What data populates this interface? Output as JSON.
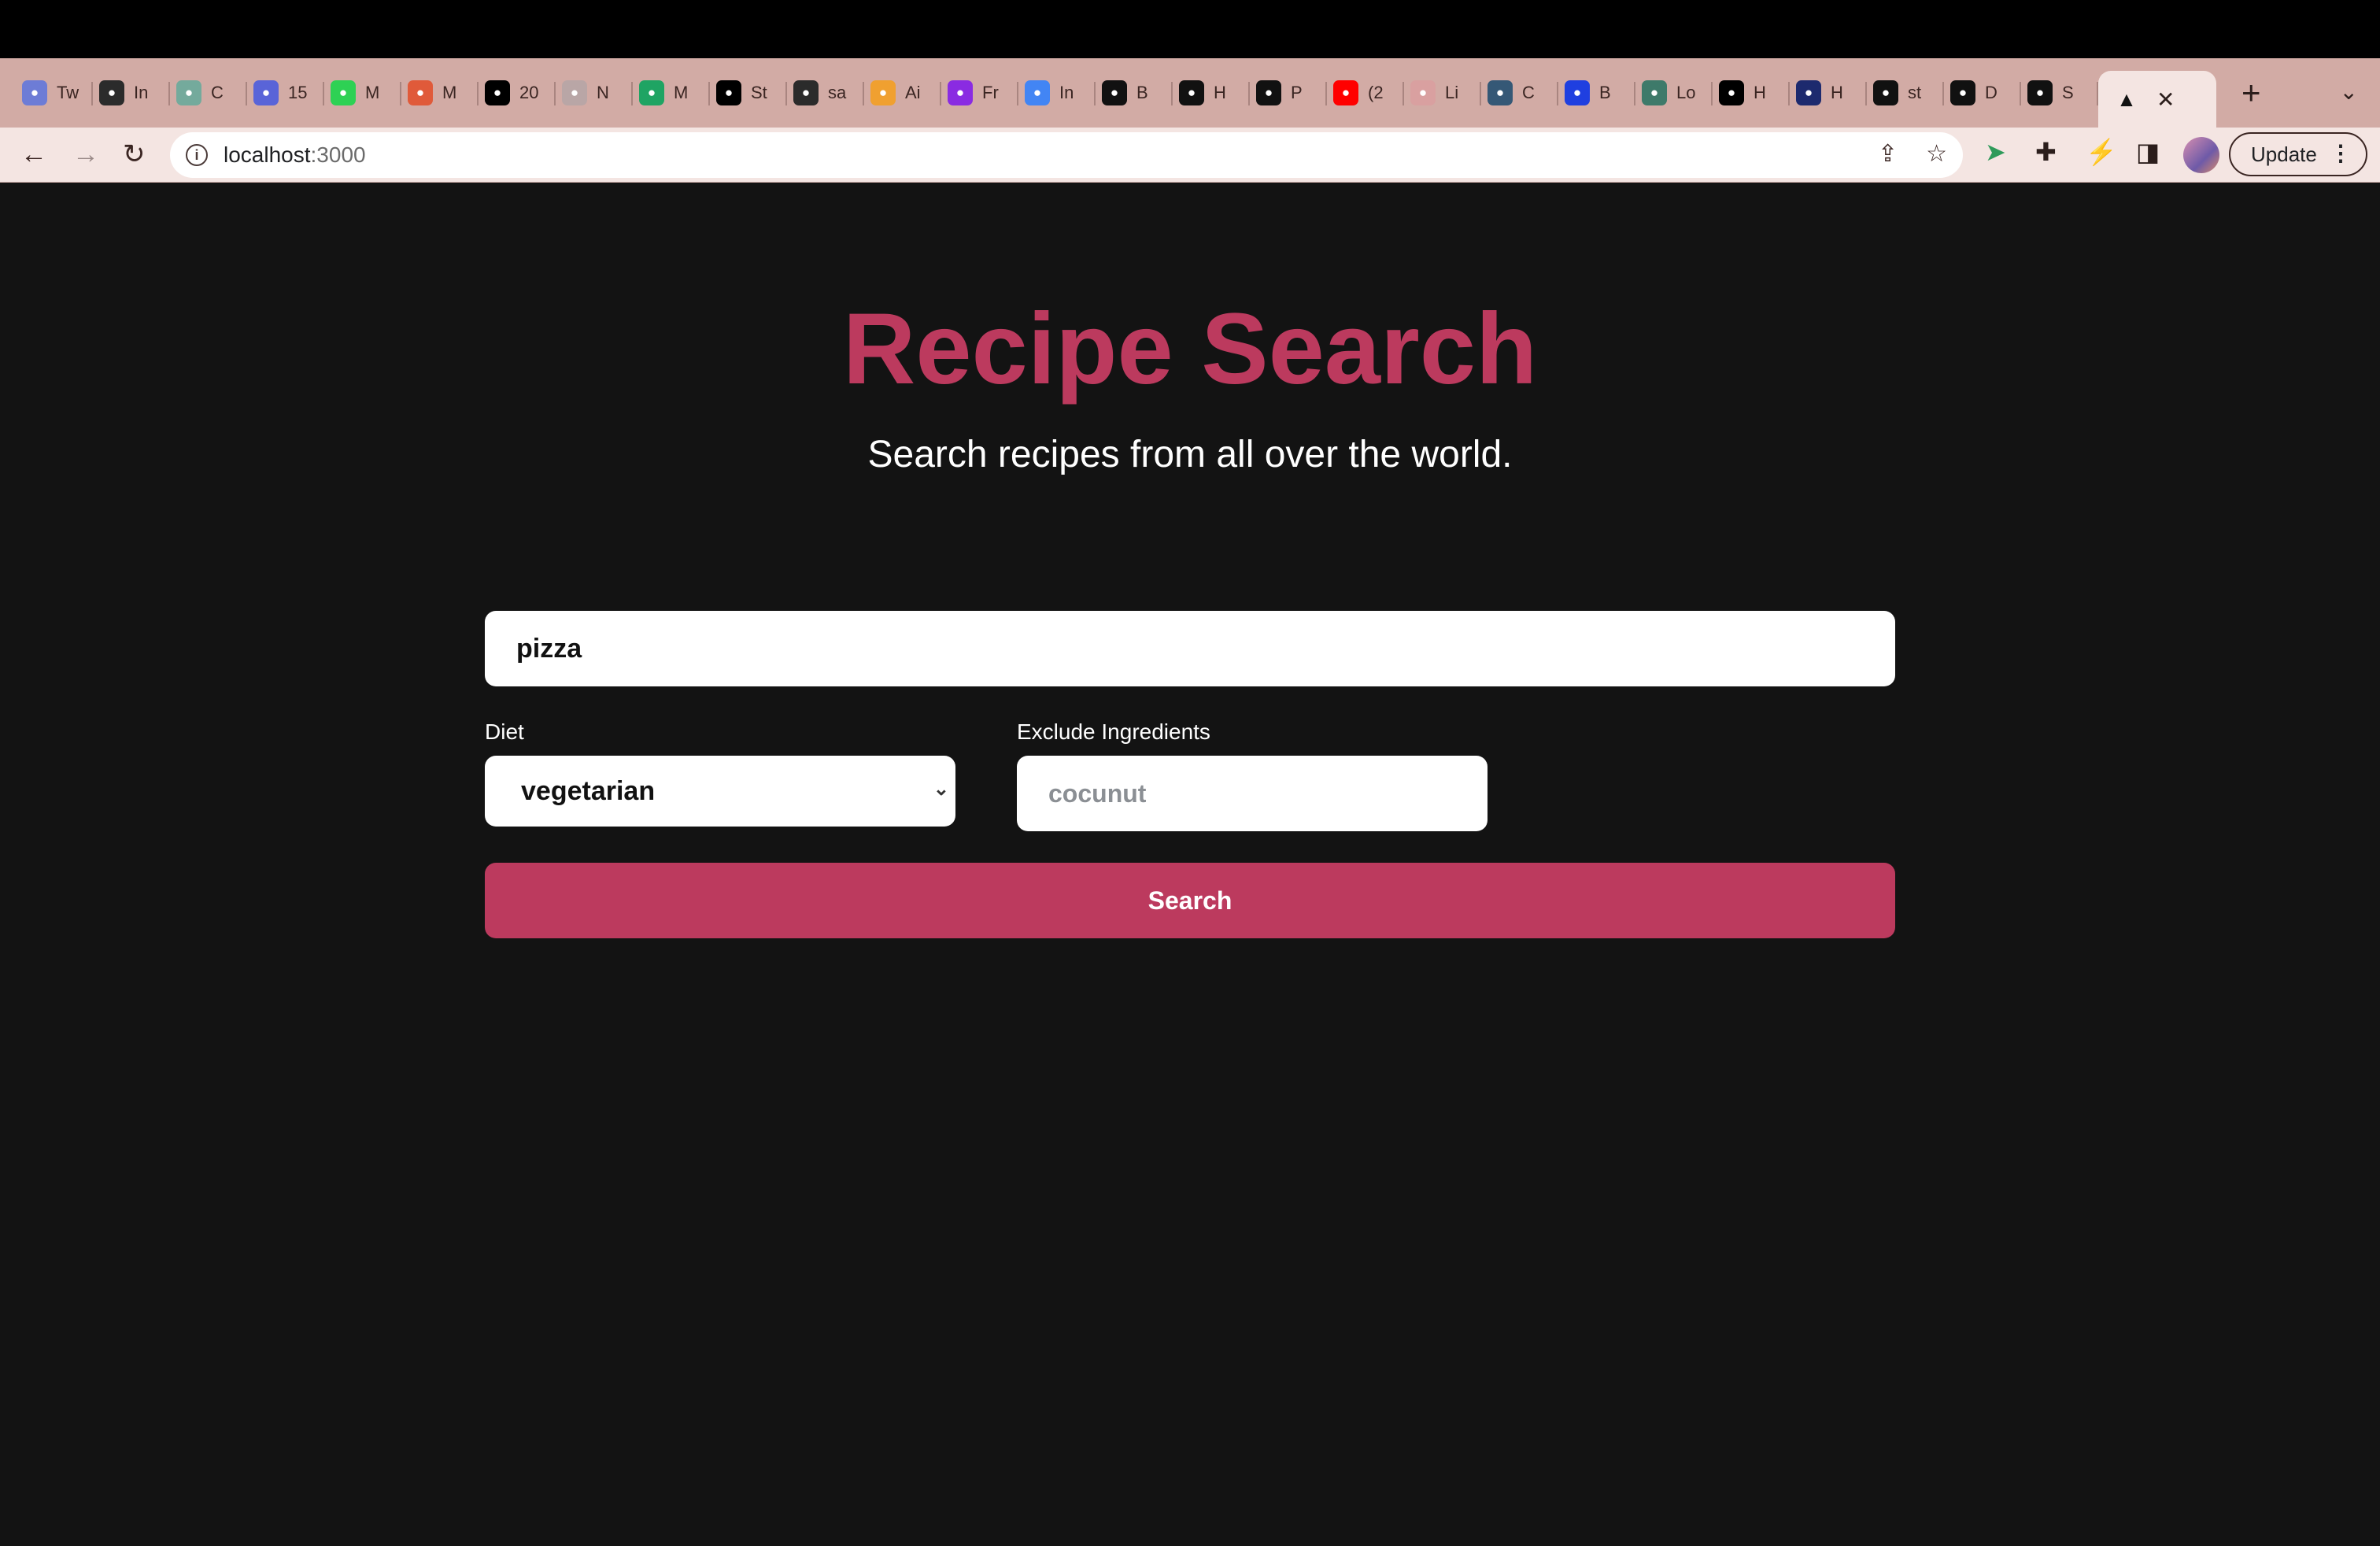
{
  "browser": {
    "tabs": [
      {
        "label": "Tw",
        "icon": "chart-trend-icon",
        "color": "#6d7cd6"
      },
      {
        "label": "In",
        "icon": "globe-icon",
        "color": "#2b2b2b"
      },
      {
        "label": "C",
        "icon": "openai-icon",
        "color": "#74aa9c"
      },
      {
        "label": "15",
        "icon": "wave-icon",
        "color": "#5964d8"
      },
      {
        "label": "M",
        "icon": "code-icon",
        "color": "#2ed154"
      },
      {
        "label": "M",
        "icon": "gauge-icon",
        "color": "#e05a3a"
      },
      {
        "label": "20",
        "icon": "medium-icon",
        "color": "#000000"
      },
      {
        "label": "N",
        "icon": "circle-icon",
        "color": "#b9a6a6"
      },
      {
        "label": "M",
        "icon": "drive-icon",
        "color": "#1fa463"
      },
      {
        "label": "St",
        "icon": "medium-icon",
        "color": "#000000"
      },
      {
        "label": "sa",
        "icon": "globe-icon",
        "color": "#2b2b2b"
      },
      {
        "label": "Ai",
        "icon": "note-icon",
        "color": "#f0a030"
      },
      {
        "label": "Fr",
        "icon": "note-icon",
        "color": "#8a2be2"
      },
      {
        "label": "In",
        "icon": "cloud-icon",
        "color": "#4285f4"
      },
      {
        "label": "B",
        "icon": "p-circle-icon",
        "color": "#111111"
      },
      {
        "label": "H",
        "icon": "p-circle-icon",
        "color": "#111111"
      },
      {
        "label": "P",
        "icon": "p-circle-icon",
        "color": "#111111"
      },
      {
        "label": "(2",
        "icon": "youtube-icon",
        "color": "#ff0000"
      },
      {
        "label": "Li",
        "icon": "avatar-icon",
        "color": "#d9a0a0"
      },
      {
        "label": "C",
        "icon": "tds-icon",
        "color": "#355876"
      },
      {
        "label": "B",
        "icon": "pe-icon",
        "color": "#1f3fe0"
      },
      {
        "label": "Lo",
        "icon": "pin-icon",
        "color": "#3e7a6a"
      },
      {
        "label": "H",
        "icon": "medium-icon",
        "color": "#000000"
      },
      {
        "label": "H",
        "icon": "b-circle-icon",
        "color": "#1d2a6e"
      },
      {
        "label": "st",
        "icon": "stack-icon",
        "color": "#111111"
      },
      {
        "label": "D",
        "icon": "bars-icon",
        "color": "#111111"
      },
      {
        "label": "S",
        "icon": "github-icon",
        "color": "#111111"
      }
    ],
    "active_tab_icon": "triangle-icon",
    "url_host": "localhost",
    "url_port": ":3000",
    "update_label": "Update"
  },
  "hero": {
    "title": "Recipe Search",
    "subtitle": "Search recipes from all over the world."
  },
  "search": {
    "query": "pizza",
    "diet_label": "Diet",
    "diet_value": "vegetarian",
    "exclude_label": "Exclude Ingredients",
    "exclude_placeholder": "cocunut",
    "button_label": "Search"
  },
  "colors": {
    "accent": "#bc3a5e",
    "background": "#131313",
    "tabstrip": "#d2aba5"
  }
}
